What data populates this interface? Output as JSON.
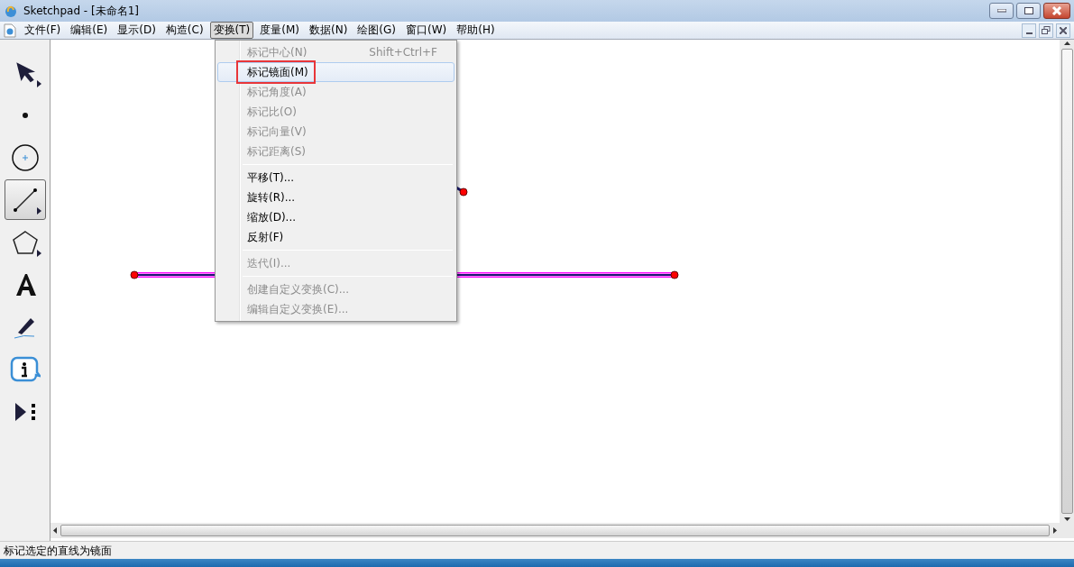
{
  "window": {
    "title": "Sketchpad  - [未命名1]"
  },
  "menubar": [
    {
      "label": "文件(F)",
      "selected": false
    },
    {
      "label": "编辑(E)",
      "selected": false
    },
    {
      "label": "显示(D)",
      "selected": false
    },
    {
      "label": "构造(C)",
      "selected": false
    },
    {
      "label": "变换(T)",
      "selected": true
    },
    {
      "label": "度量(M)",
      "selected": false
    },
    {
      "label": "数据(N)",
      "selected": false
    },
    {
      "label": "绘图(G)",
      "selected": false
    },
    {
      "label": "窗口(W)",
      "selected": false
    },
    {
      "label": "帮助(H)",
      "selected": false
    }
  ],
  "tools": [
    {
      "kind": "arrow",
      "selected": false,
      "submenu": true
    },
    {
      "kind": "point",
      "selected": false,
      "submenu": false
    },
    {
      "kind": "compass",
      "selected": false,
      "submenu": false
    },
    {
      "kind": "straightedge",
      "selected": true,
      "submenu": true
    },
    {
      "kind": "polygon",
      "selected": false,
      "submenu": true
    },
    {
      "kind": "text",
      "selected": false,
      "submenu": false
    },
    {
      "kind": "marker",
      "selected": false,
      "submenu": false
    },
    {
      "kind": "info",
      "selected": false,
      "submenu": false
    },
    {
      "kind": "custom",
      "selected": false,
      "submenu": false
    }
  ],
  "menu": [
    {
      "kind": "item",
      "label": "标记中心(N)",
      "shortcut": "Shift+Ctrl+F",
      "disabled": true,
      "selected": false,
      "outlined": false
    },
    {
      "kind": "item",
      "label": "标记镜面(M)",
      "disabled": false,
      "selected": true,
      "outlined": true
    },
    {
      "kind": "item",
      "label": "标记角度(A)",
      "disabled": true,
      "selected": false,
      "outlined": false
    },
    {
      "kind": "item",
      "label": "标记比(O)",
      "disabled": true,
      "selected": false,
      "outlined": false
    },
    {
      "kind": "item",
      "label": "标记向量(V)",
      "disabled": true,
      "selected": false,
      "outlined": false
    },
    {
      "kind": "item",
      "label": "标记距离(S)",
      "disabled": true,
      "selected": false,
      "outlined": false
    },
    {
      "kind": "separator"
    },
    {
      "kind": "item",
      "label": "平移(T)...",
      "disabled": false,
      "selected": false,
      "outlined": false
    },
    {
      "kind": "item",
      "label": "旋转(R)...",
      "disabled": false,
      "selected": false,
      "outlined": false
    },
    {
      "kind": "item",
      "label": "缩放(D)...",
      "disabled": false,
      "selected": false,
      "outlined": false
    },
    {
      "kind": "item",
      "label": "反射(F)",
      "disabled": false,
      "selected": false,
      "outlined": false
    },
    {
      "kind": "separator"
    },
    {
      "kind": "item",
      "label": "迭代(I)...",
      "disabled": true,
      "selected": false,
      "outlined": false
    },
    {
      "kind": "separator"
    },
    {
      "kind": "item",
      "label": "创建自定义变换(C)...",
      "disabled": true,
      "selected": false,
      "outlined": false
    },
    {
      "kind": "item",
      "label": "编辑自定义变换(E)...",
      "disabled": true,
      "selected": false,
      "outlined": false
    }
  ],
  "canvas": {
    "segment_selected": true
  },
  "status_bar": {
    "text": "标记选定的直线为镜面"
  }
}
